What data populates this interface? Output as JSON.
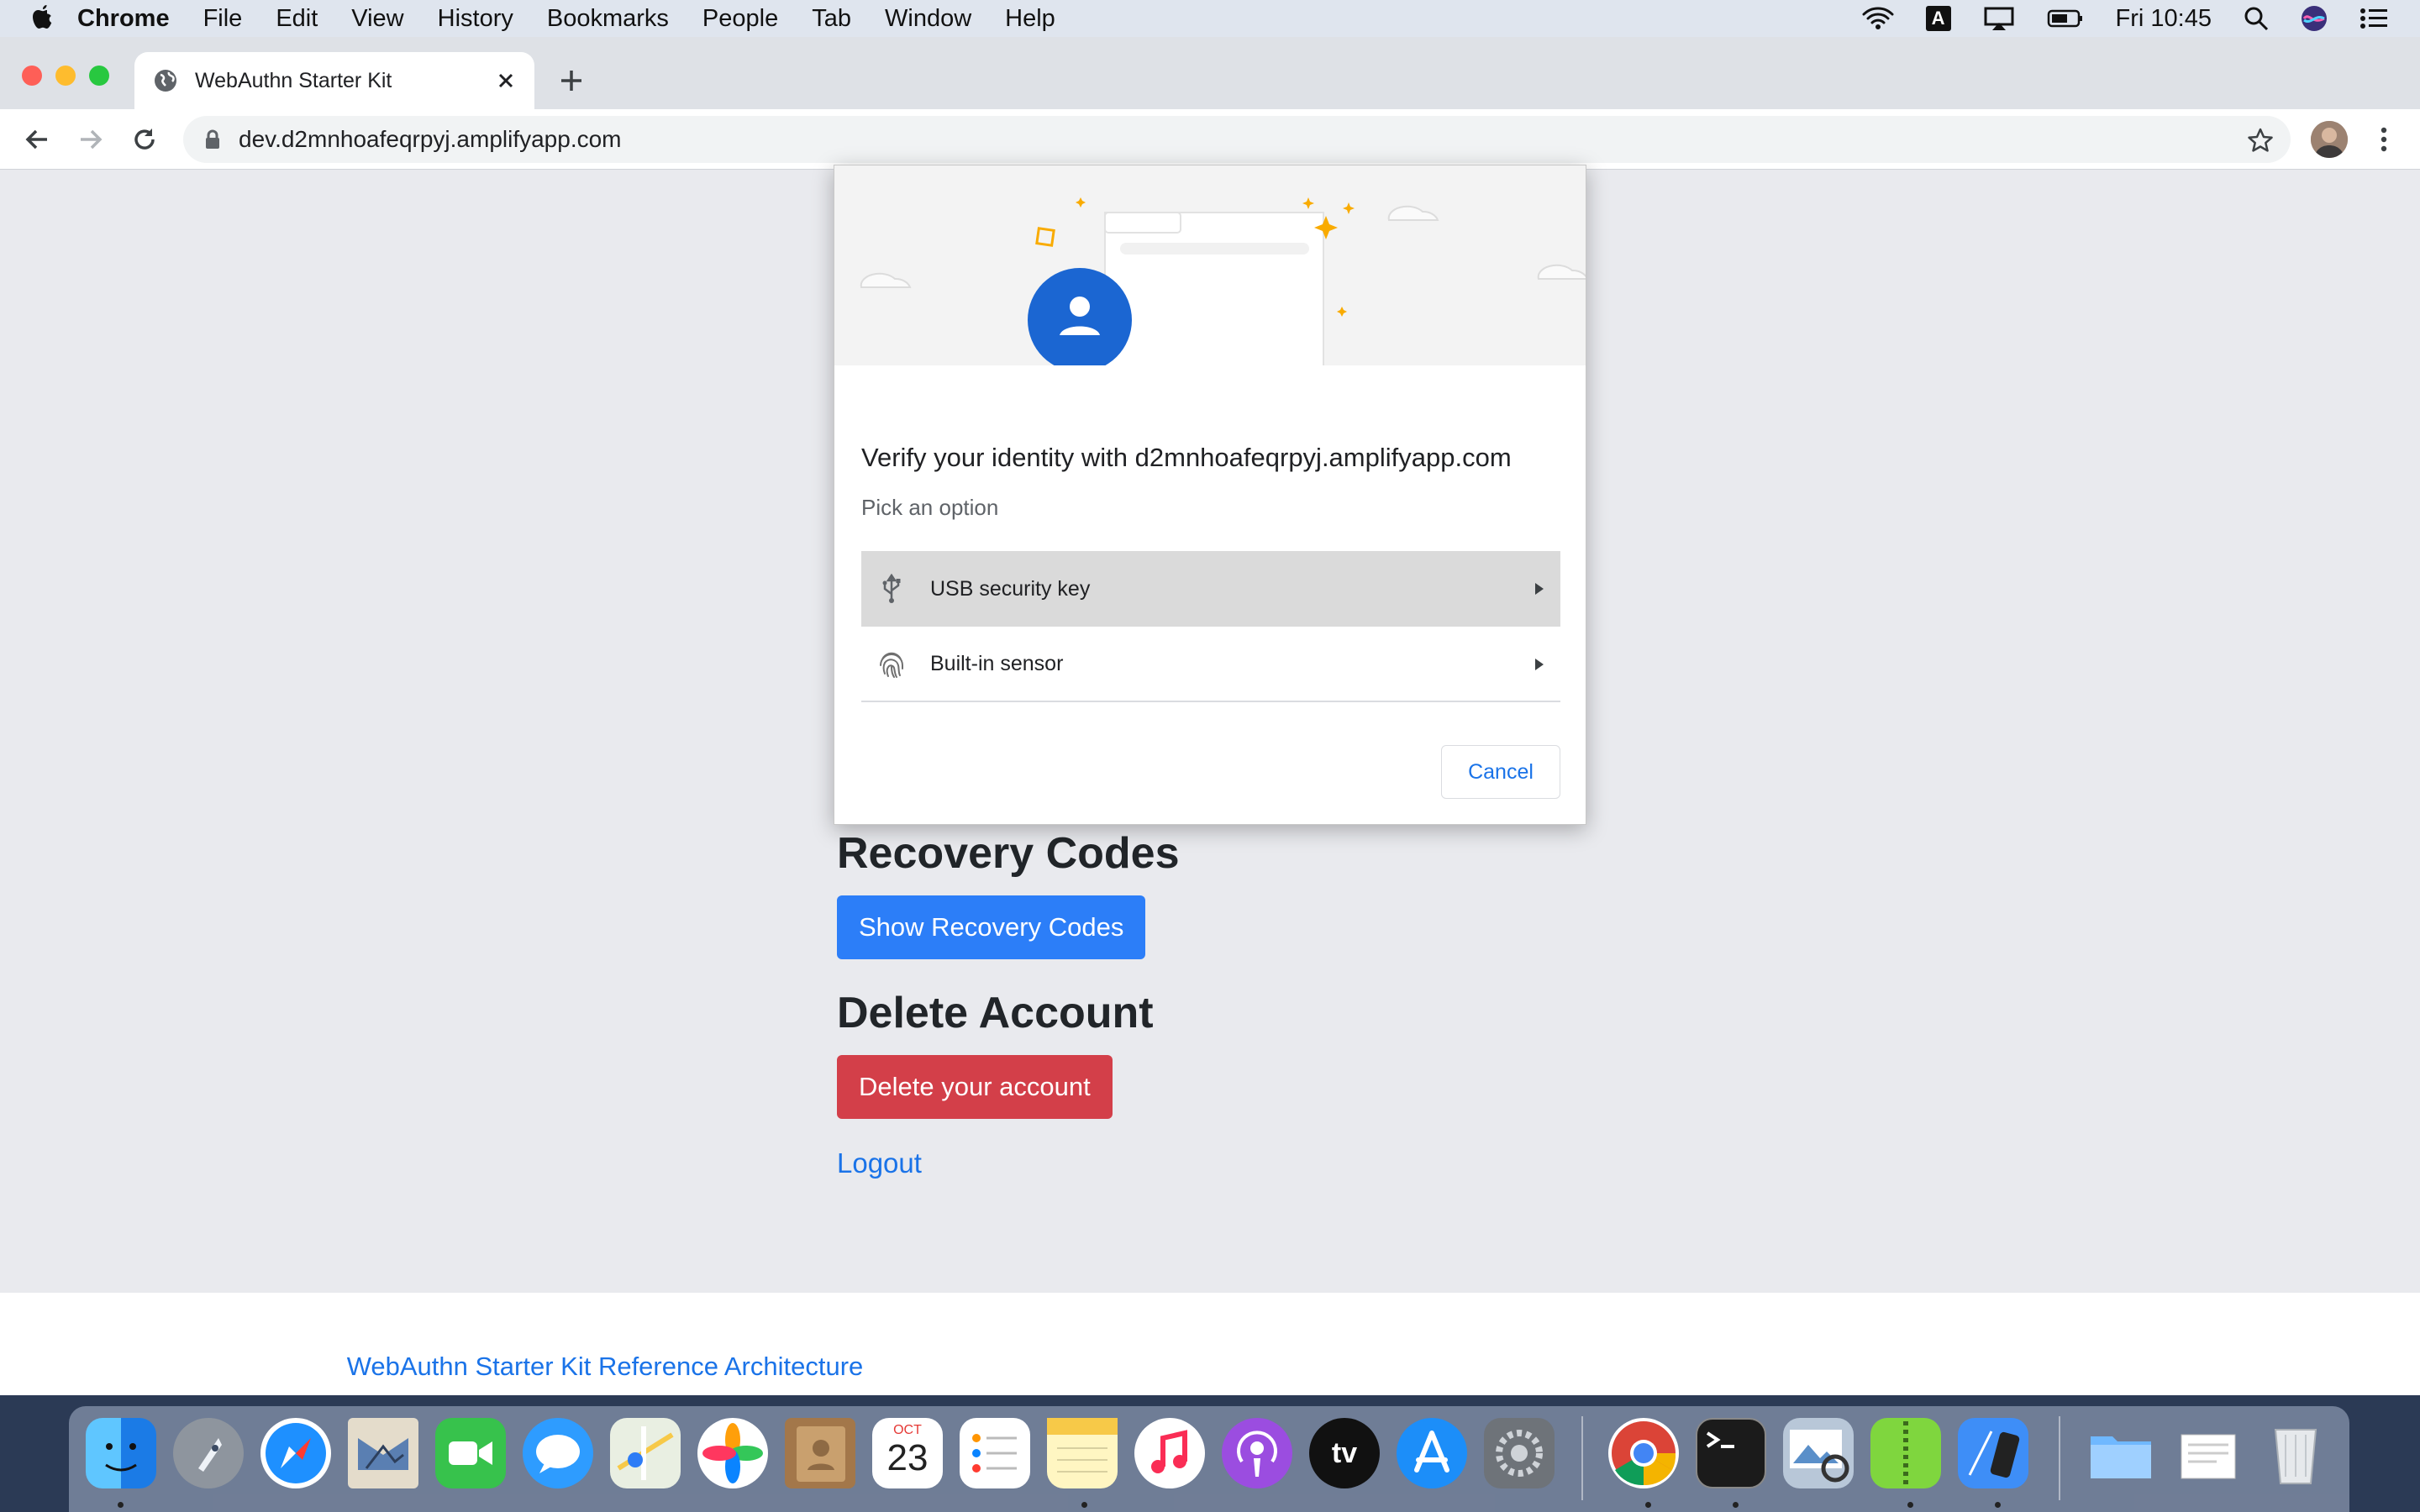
{
  "menubar": {
    "app_name": "Chrome",
    "items": [
      "File",
      "Edit",
      "View",
      "History",
      "Bookmarks",
      "People",
      "Tab",
      "Window",
      "Help"
    ],
    "clock": "Fri 10:45",
    "input_source": "A"
  },
  "browser": {
    "tab_title": "WebAuthn Starter Kit",
    "url": "dev.d2mnhoafeqrpyj.amplifyapp.com"
  },
  "page": {
    "recovery_heading": "Recovery Codes",
    "show_recovery_button": "Show Recovery Codes",
    "delete_heading": "Delete Account",
    "delete_button": "Delete your account",
    "logout_link": "Logout",
    "footer_link": "WebAuthn Starter Kit Reference Architecture",
    "colors": {
      "primary": "#2c7ef8",
      "danger": "#d33f49",
      "link": "#1a73e8",
      "page_bg": "#e9eaee"
    }
  },
  "dialog": {
    "title": "Verify your identity with d2mnhoafeqrpyj.amplifyapp.com",
    "subtitle": "Pick an option",
    "options": [
      {
        "label": "USB security key",
        "icon": "usb-icon",
        "highlighted": true
      },
      {
        "label": "Built-in sensor",
        "icon": "fingerprint-icon",
        "highlighted": false
      }
    ],
    "cancel_label": "Cancel"
  },
  "dock": {
    "calendar_month": "OCT",
    "calendar_day": "23",
    "tv_label": "tv",
    "apps": [
      "finder-icon",
      "launchpad-icon",
      "safari-icon",
      "mail-icon",
      "facetime-icon",
      "messages-icon",
      "maps-icon",
      "photos-icon",
      "contacts-icon",
      "calendar-icon",
      "reminders-icon",
      "notes-icon",
      "music-icon",
      "podcasts-icon",
      "tv-icon",
      "app-store-icon",
      "system-preferences-icon",
      "chrome-icon",
      "terminal-icon",
      "preview-icon",
      "archive-utility-icon",
      "xcode-simulator-icon",
      "folder-icon",
      "documents-stack-icon",
      "trash-icon"
    ]
  }
}
